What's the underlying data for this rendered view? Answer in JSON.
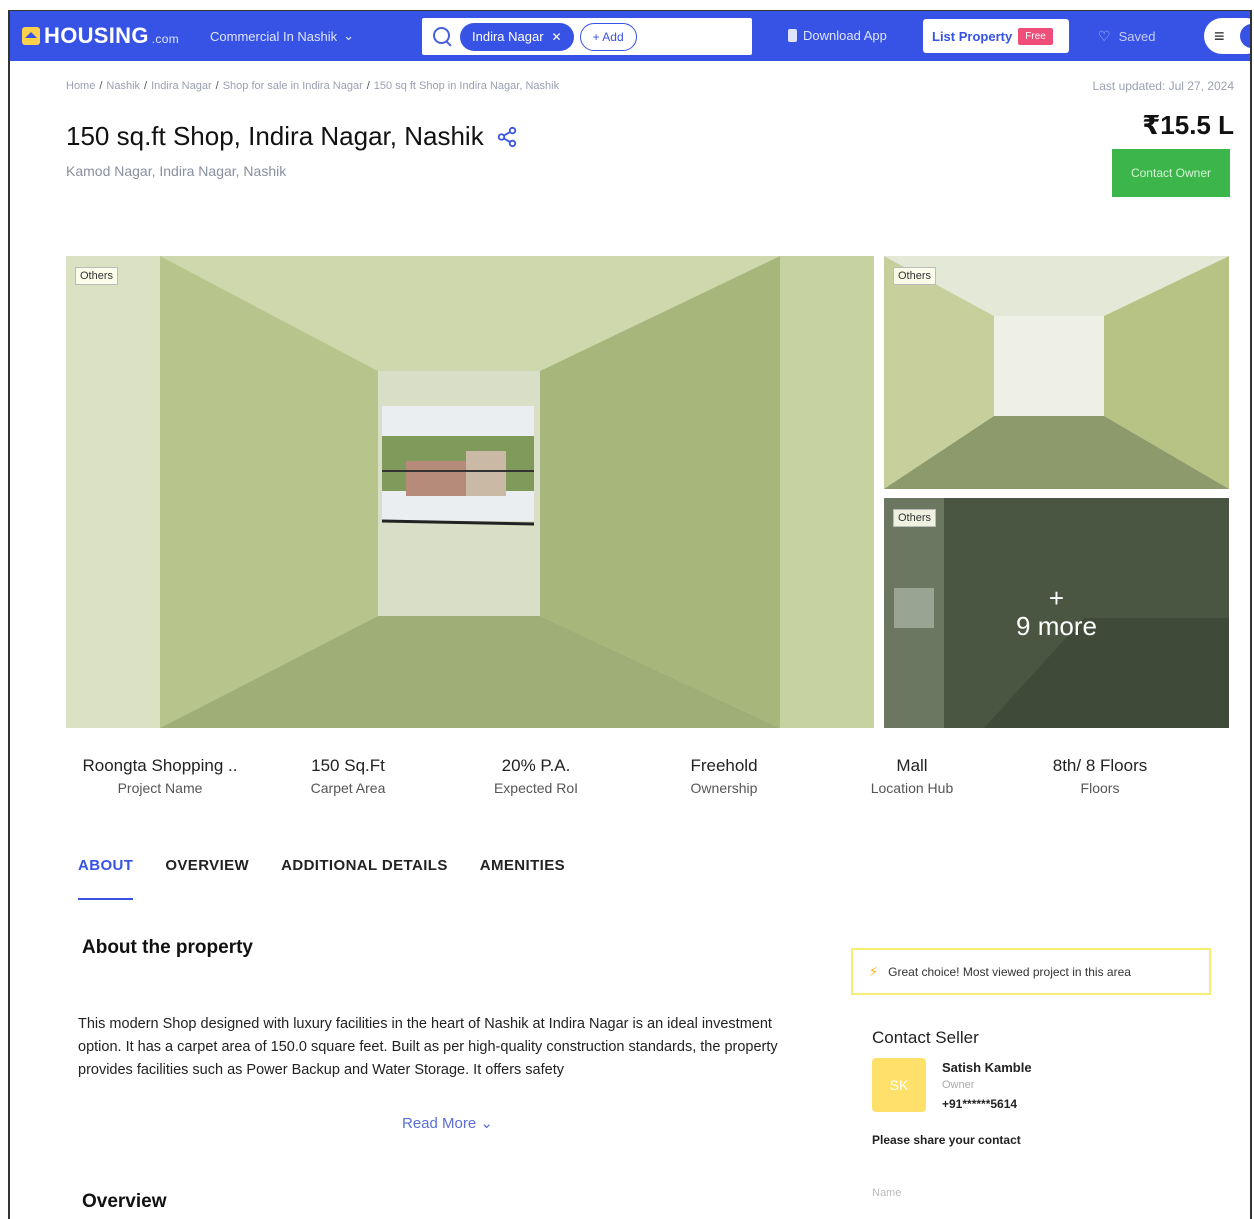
{
  "header": {
    "logo_text": "HOUSING",
    "logo_suffix": ".com",
    "city_select": "Commercial In Nashik",
    "search_chip": "Indira Nagar",
    "add_label": "+ Add",
    "download_app": "Download App",
    "list_property": "List Property",
    "free_badge": "Free",
    "saved": "Saved"
  },
  "breadcrumb": {
    "items": [
      "Home",
      "Nashik",
      "Indira Nagar",
      "Shop for sale in Indira Nagar",
      "150 sq ft Shop in Indira Nagar, Nashik"
    ]
  },
  "last_updated": "Last updated: Jul 27, 2024",
  "listing": {
    "title": "150 sq.ft Shop, Indira Nagar, Nashik",
    "address": "Kamod Nagar, Indira Nagar, Nashik",
    "price": "₹15.5 L",
    "contact_button": "Contact Owner"
  },
  "gallery": {
    "tag": "Others",
    "more_plus": "+",
    "more_text": "9 more"
  },
  "stats": [
    {
      "value": "Roongta Shopping ..",
      "label": "Project Name"
    },
    {
      "value": "150 Sq.Ft",
      "label": "Carpet Area"
    },
    {
      "value": "20% P.A.",
      "label": "Expected RoI"
    },
    {
      "value": "Freehold",
      "label": "Ownership"
    },
    {
      "value": "Mall",
      "label": "Location Hub"
    },
    {
      "value": "8th/ 8 Floors",
      "label": "Floors"
    }
  ],
  "tabs": [
    "ABOUT",
    "OVERVIEW",
    "ADDITIONAL DETAILS",
    "AMENITIES"
  ],
  "about": {
    "heading": "About the property",
    "text": "This modern Shop designed with luxury facilities in the heart of Nashik at Indira Nagar is an ideal investment option. It has a carpet area of 150.0 square feet. Built as per high-quality construction standards, the property provides facilities such as Power Backup and Water Storage. It offers safety",
    "read_more": "Read More ⌄"
  },
  "overview_heading": "Overview",
  "highlight": "Great choice! Most viewed project in this area",
  "seller": {
    "title": "Contact Seller",
    "initials": "SK",
    "name": "Satish Kamble",
    "role": "Owner",
    "phone": "+91******5614",
    "share_prompt": "Please share your contact",
    "name_placeholder": "Name"
  },
  "colors": {
    "brand_blue": "#3753e6",
    "contact_green": "#3cb54a",
    "highlight_yellow": "#f5ee70",
    "free_pink": "#ee4e77"
  }
}
